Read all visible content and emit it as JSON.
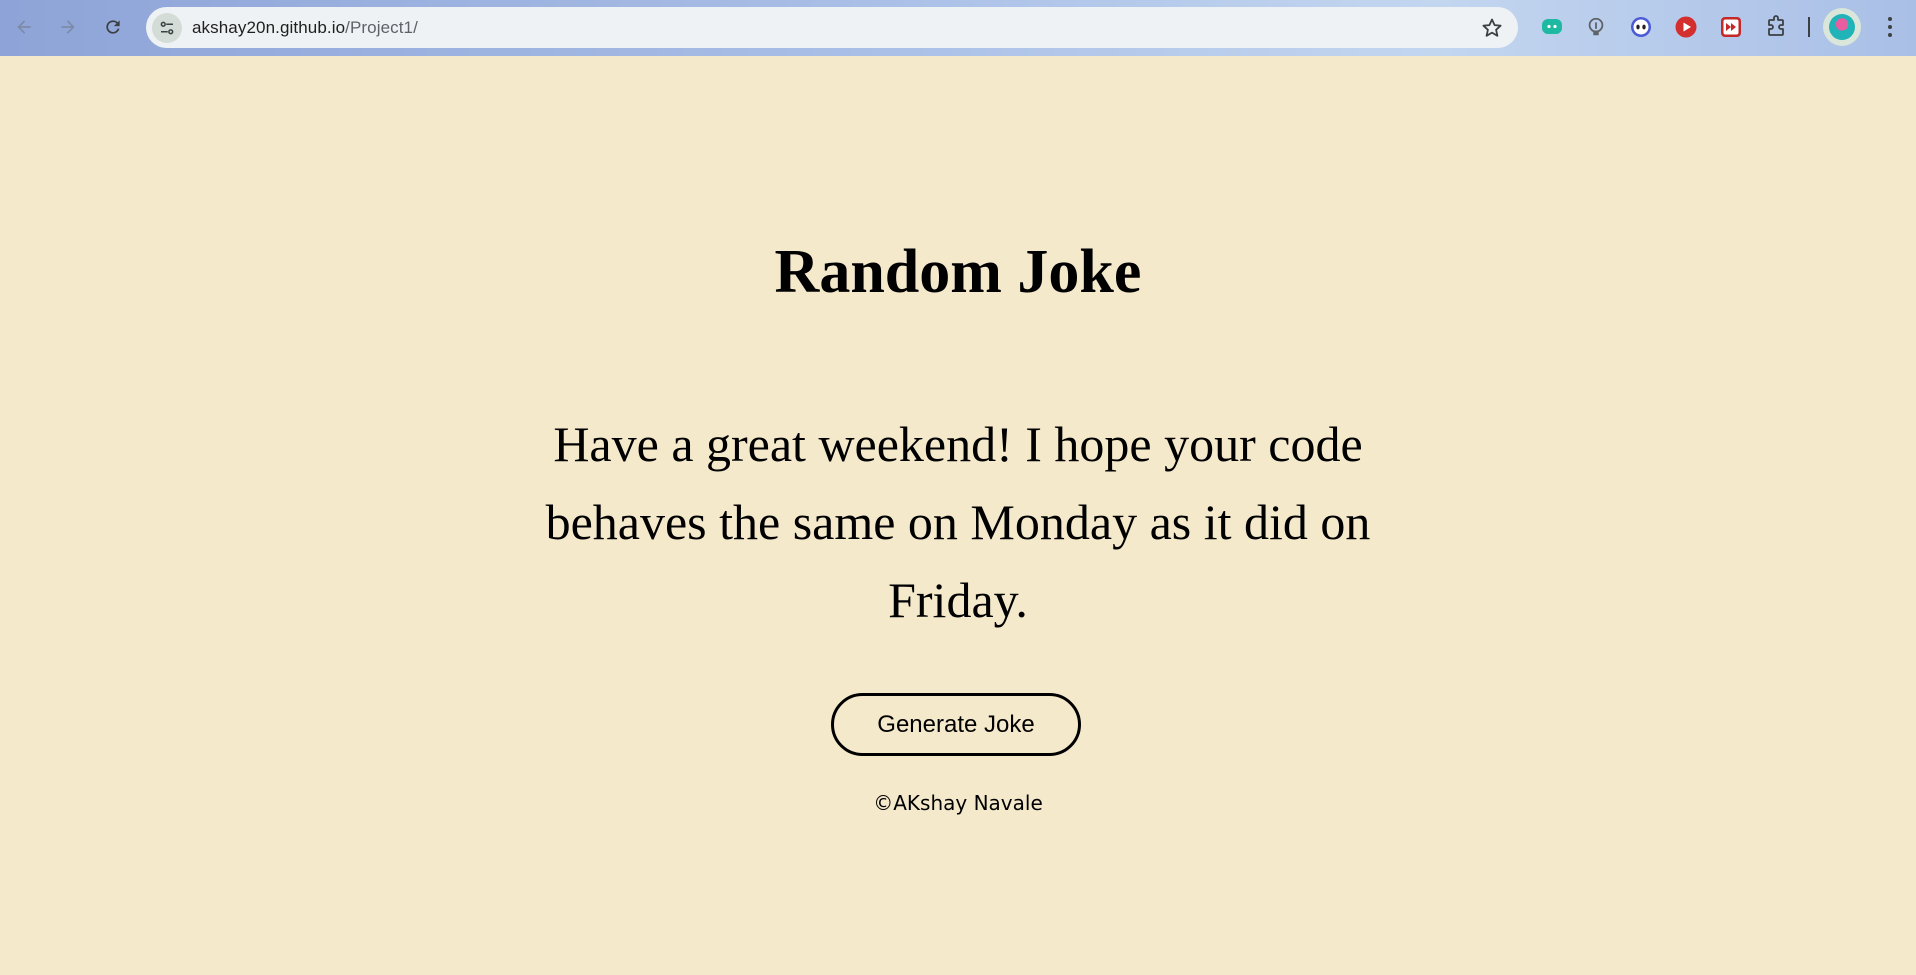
{
  "browser": {
    "url_host": "akshay20n.github.io",
    "url_path": "/Project1/",
    "back_icon": "arrow-left-icon",
    "forward_icon": "arrow-right-icon",
    "reload_icon": "reload-icon",
    "bookmark_icon": "star-icon",
    "extensions": [
      {
        "name": "chat-extension-icon",
        "color": "#1db9a3"
      },
      {
        "name": "bulb-extension-icon",
        "color": "#5f6368"
      },
      {
        "name": "mask-extension-icon",
        "color": "#4b5bd6"
      },
      {
        "name": "play-extension-icon",
        "color": "#d32f2f"
      },
      {
        "name": "fast-forward-extension-icon",
        "color": "#c62828"
      },
      {
        "name": "puzzle-extensions-icon",
        "color": "#3c4043"
      }
    ]
  },
  "page": {
    "title": "Random Joke",
    "joke": "Have a great weekend! I hope your code behaves the same on Monday as it did on Friday.",
    "button_label": "Generate Joke",
    "footer": "©AKshay Navale",
    "background_color": "#f5e9cc"
  }
}
